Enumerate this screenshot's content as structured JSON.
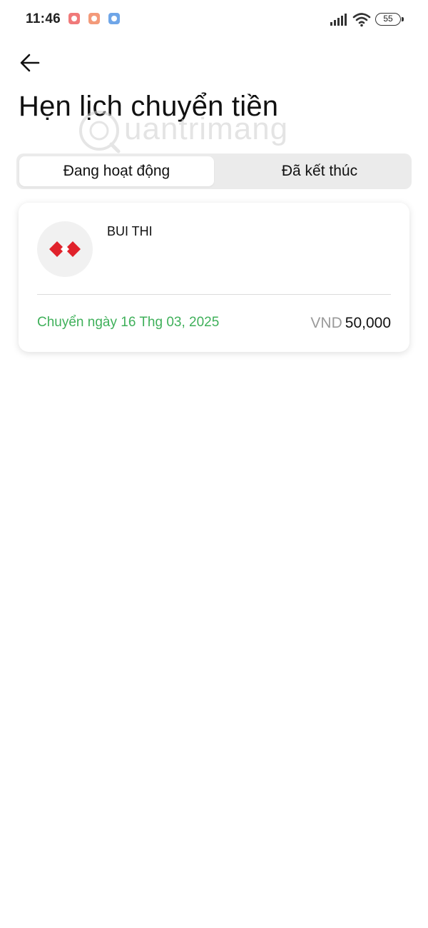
{
  "status_bar": {
    "time": "11:46",
    "battery": "55",
    "app_icons": [
      "notification-app-icon",
      "notification-app-icon",
      "notification-app-icon"
    ]
  },
  "header": {
    "back_icon": "arrow-left-icon",
    "title": "Hẹn lịch chuyển tiền"
  },
  "watermark": {
    "text": "uantrimang"
  },
  "tabs": [
    {
      "label": "Đang hoạt động",
      "active": true
    },
    {
      "label": "Đã kết thúc",
      "active": false
    }
  ],
  "transfers": [
    {
      "recipient": "BUI THI",
      "bank_icon": "bank-logo-icon",
      "date": "Chuyển ngày 16 Thg 03, 2025",
      "currency": "VND",
      "amount": "50,000"
    }
  ],
  "colors": {
    "accent_green": "#3fb05a",
    "bank_logo_red": "#e0222b",
    "tab_bg": "#ebebeb"
  }
}
